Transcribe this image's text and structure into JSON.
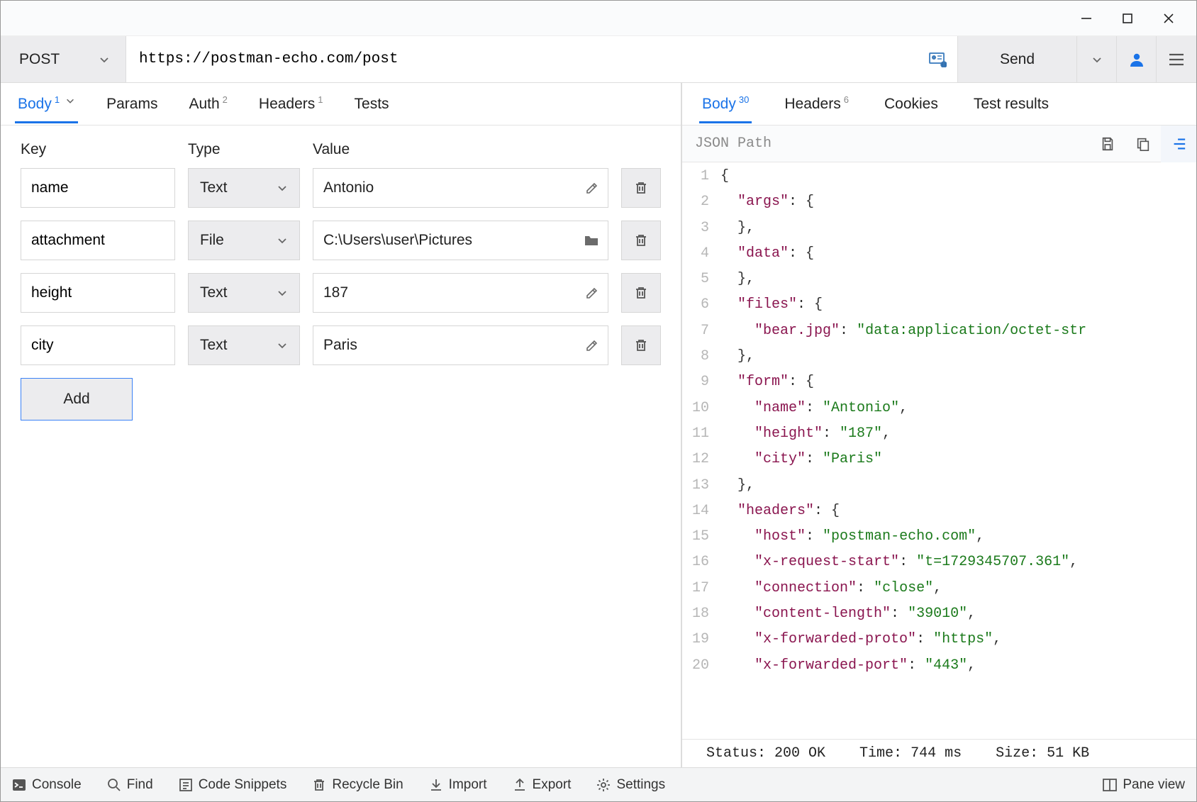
{
  "toolbar": {
    "method": "POST",
    "url": "https://postman-echo.com/post",
    "send_label": "Send"
  },
  "request_tabs": {
    "body": {
      "label": "Body",
      "badge": "1"
    },
    "params": {
      "label": "Params"
    },
    "auth": {
      "label": "Auth",
      "badge": "2"
    },
    "headers": {
      "label": "Headers",
      "badge": "1"
    },
    "tests": {
      "label": "Tests"
    }
  },
  "form": {
    "col_key": "Key",
    "col_type": "Type",
    "col_value": "Value",
    "rows": [
      {
        "key": "name",
        "type": "Text",
        "value": "Antonio",
        "value_kind": "text"
      },
      {
        "key": "attachment",
        "type": "File",
        "value": "C:\\Users\\user\\Pictures",
        "value_kind": "file"
      },
      {
        "key": "height",
        "type": "Text",
        "value": "187",
        "value_kind": "text"
      },
      {
        "key": "city",
        "type": "Text",
        "value": "Paris",
        "value_kind": "text"
      }
    ],
    "add_label": "Add"
  },
  "response_tabs": {
    "body": {
      "label": "Body",
      "badge": "30"
    },
    "headers": {
      "label": "Headers",
      "badge": "6"
    },
    "cookies": {
      "label": "Cookies"
    },
    "test_results": {
      "label": "Test results"
    }
  },
  "response_toolbar": {
    "jsonpath_placeholder": "JSON Path"
  },
  "response_json_lines": [
    {
      "n": 1,
      "indent": 0,
      "tokens": [
        {
          "t": "p",
          "v": "{"
        }
      ]
    },
    {
      "n": 2,
      "indent": 1,
      "tokens": [
        {
          "t": "k",
          "v": "\"args\""
        },
        {
          "t": "p",
          "v": ": {"
        }
      ]
    },
    {
      "n": 3,
      "indent": 1,
      "tokens": [
        {
          "t": "p",
          "v": "},"
        }
      ]
    },
    {
      "n": 4,
      "indent": 1,
      "tokens": [
        {
          "t": "k",
          "v": "\"data\""
        },
        {
          "t": "p",
          "v": ": {"
        }
      ]
    },
    {
      "n": 5,
      "indent": 1,
      "tokens": [
        {
          "t": "p",
          "v": "},"
        }
      ]
    },
    {
      "n": 6,
      "indent": 1,
      "tokens": [
        {
          "t": "k",
          "v": "\"files\""
        },
        {
          "t": "p",
          "v": ": {"
        }
      ]
    },
    {
      "n": 7,
      "indent": 2,
      "tokens": [
        {
          "t": "k",
          "v": "\"bear.jpg\""
        },
        {
          "t": "p",
          "v": ": "
        },
        {
          "t": "s",
          "v": "\"data:application/octet-str"
        }
      ]
    },
    {
      "n": 8,
      "indent": 1,
      "tokens": [
        {
          "t": "p",
          "v": "},"
        }
      ]
    },
    {
      "n": 9,
      "indent": 1,
      "tokens": [
        {
          "t": "k",
          "v": "\"form\""
        },
        {
          "t": "p",
          "v": ": {"
        }
      ]
    },
    {
      "n": 10,
      "indent": 2,
      "tokens": [
        {
          "t": "k",
          "v": "\"name\""
        },
        {
          "t": "p",
          "v": ": "
        },
        {
          "t": "s",
          "v": "\"Antonio\""
        },
        {
          "t": "p",
          "v": ","
        }
      ]
    },
    {
      "n": 11,
      "indent": 2,
      "tokens": [
        {
          "t": "k",
          "v": "\"height\""
        },
        {
          "t": "p",
          "v": ": "
        },
        {
          "t": "s",
          "v": "\"187\""
        },
        {
          "t": "p",
          "v": ","
        }
      ]
    },
    {
      "n": 12,
      "indent": 2,
      "tokens": [
        {
          "t": "k",
          "v": "\"city\""
        },
        {
          "t": "p",
          "v": ": "
        },
        {
          "t": "s",
          "v": "\"Paris\""
        }
      ]
    },
    {
      "n": 13,
      "indent": 1,
      "tokens": [
        {
          "t": "p",
          "v": "},"
        }
      ]
    },
    {
      "n": 14,
      "indent": 1,
      "tokens": [
        {
          "t": "k",
          "v": "\"headers\""
        },
        {
          "t": "p",
          "v": ": {"
        }
      ]
    },
    {
      "n": 15,
      "indent": 2,
      "tokens": [
        {
          "t": "k",
          "v": "\"host\""
        },
        {
          "t": "p",
          "v": ": "
        },
        {
          "t": "s",
          "v": "\"postman-echo.com\""
        },
        {
          "t": "p",
          "v": ","
        }
      ]
    },
    {
      "n": 16,
      "indent": 2,
      "tokens": [
        {
          "t": "k",
          "v": "\"x-request-start\""
        },
        {
          "t": "p",
          "v": ": "
        },
        {
          "t": "s",
          "v": "\"t=1729345707.361\""
        },
        {
          "t": "p",
          "v": ","
        }
      ]
    },
    {
      "n": 17,
      "indent": 2,
      "tokens": [
        {
          "t": "k",
          "v": "\"connection\""
        },
        {
          "t": "p",
          "v": ": "
        },
        {
          "t": "s",
          "v": "\"close\""
        },
        {
          "t": "p",
          "v": ","
        }
      ]
    },
    {
      "n": 18,
      "indent": 2,
      "tokens": [
        {
          "t": "k",
          "v": "\"content-length\""
        },
        {
          "t": "p",
          "v": ": "
        },
        {
          "t": "s",
          "v": "\"39010\""
        },
        {
          "t": "p",
          "v": ","
        }
      ]
    },
    {
      "n": 19,
      "indent": 2,
      "tokens": [
        {
          "t": "k",
          "v": "\"x-forwarded-proto\""
        },
        {
          "t": "p",
          "v": ": "
        },
        {
          "t": "s",
          "v": "\"https\""
        },
        {
          "t": "p",
          "v": ","
        }
      ]
    },
    {
      "n": 20,
      "indent": 2,
      "tokens": [
        {
          "t": "k",
          "v": "\"x-forwarded-port\""
        },
        {
          "t": "p",
          "v": ": "
        },
        {
          "t": "s",
          "v": "\"443\""
        },
        {
          "t": "p",
          "v": ","
        }
      ]
    }
  ],
  "status": {
    "status_label": "Status:",
    "status_value": "200 OK",
    "time_label": "Time:",
    "time_value": "744 ms",
    "size_label": "Size:",
    "size_value": "51 KB"
  },
  "bottombar": {
    "console": "Console",
    "find": "Find",
    "snippets": "Code Snippets",
    "recycle": "Recycle Bin",
    "import": "Import",
    "export": "Export",
    "settings": "Settings",
    "pane_view": "Pane view"
  }
}
